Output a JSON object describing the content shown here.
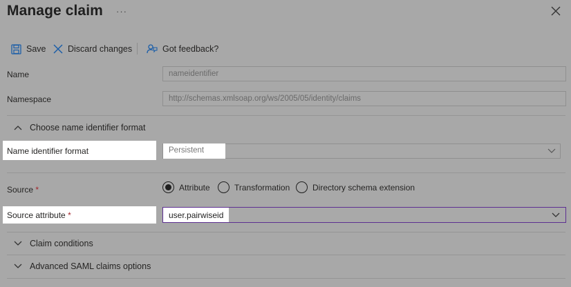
{
  "header": {
    "title": "Manage claim",
    "more_label": "···"
  },
  "toolbar": {
    "save_label": "Save",
    "discard_label": "Discard changes",
    "feedback_label": "Got feedback?"
  },
  "name": {
    "label": "Name",
    "value": "nameidentifier"
  },
  "namespace": {
    "label": "Namespace",
    "value": "http://schemas.xmlsoap.org/ws/2005/05/identity/claims"
  },
  "name_id_section": {
    "label": "Choose name identifier format"
  },
  "name_id_format": {
    "label": "Name identifier format",
    "value": "Persistent"
  },
  "source": {
    "label": "Source",
    "required": "*",
    "options": [
      {
        "label": "Attribute",
        "selected": true
      },
      {
        "label": "Transformation",
        "selected": false
      },
      {
        "label": "Directory schema extension",
        "selected": false
      }
    ]
  },
  "source_attribute": {
    "label": "Source attribute",
    "required": "*",
    "value": "user.pairwiseid"
  },
  "sections": {
    "claim_conditions": "Claim conditions",
    "advanced_saml": "Advanced SAML claims options"
  },
  "colors": {
    "overlay": "#a9a9a9",
    "highlight": "#ffffff",
    "accent_border": "#5c2e91",
    "required": "#a4262c"
  }
}
